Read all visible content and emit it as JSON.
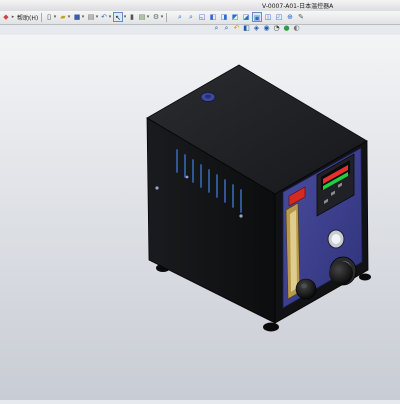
{
  "window": {
    "title": "V-0007-A01-日本温控器A"
  },
  "menu": {
    "help_label": "帮助(H)"
  },
  "toolbar": {
    "new_icon": "new-document-icon",
    "open_icon": "open-folder-icon",
    "save_icon": "save-icon",
    "print_icon": "print-icon",
    "undo_icon": "undo-icon",
    "select_icon": "select-arrow-icon",
    "rebuild_icon": "rebuild-icon",
    "options_icon": "options-icon"
  },
  "view_toolbar": {
    "items": [
      "zoom-to-fit-icon",
      "zoom-area-icon",
      "previous-view-icon",
      "section-view-icon",
      "view-orientation-icon",
      "display-style-icon",
      "hide-show-icon",
      "appearance-icon",
      "scene-icon",
      "view-settings-icon"
    ]
  },
  "colors": {
    "viewport_top": "#f3f4f6",
    "viewport_bottom": "#c8ccd4",
    "enclosure": "#151618",
    "front_panel": "#3d3f8e",
    "display_digits": "#e8302a",
    "display_green": "#1fd040"
  }
}
